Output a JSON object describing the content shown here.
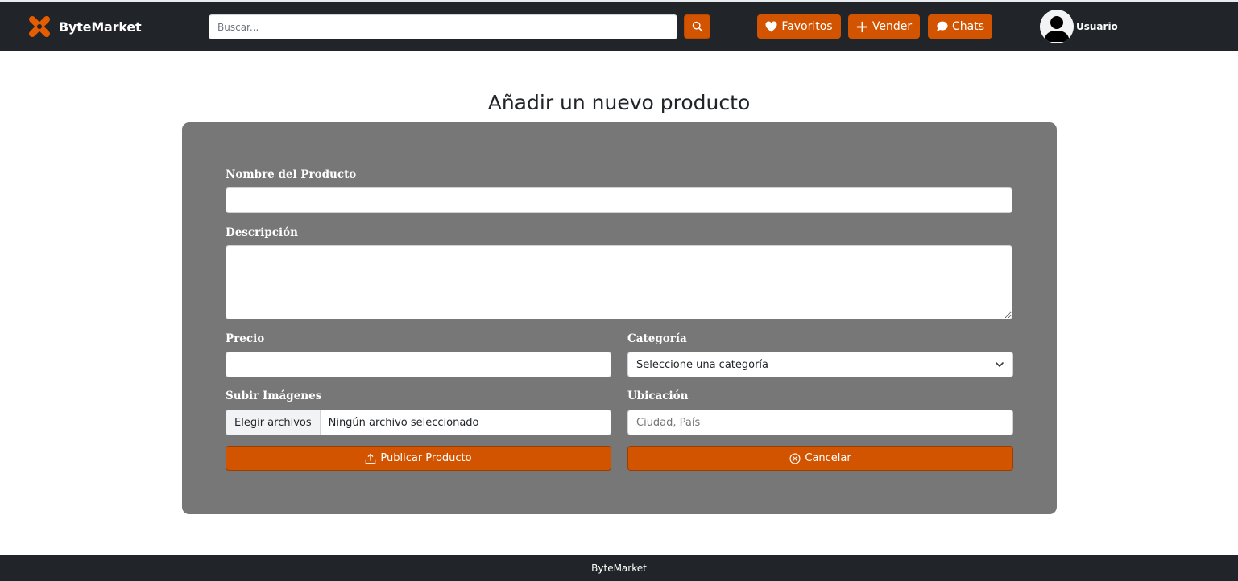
{
  "header": {
    "brand": "ByteMarket",
    "logo_icon": "bytemarket-x-logo-icon",
    "search_placeholder": "Buscar...",
    "search_icon": "search-icon",
    "buttons": {
      "favoritos": "Favoritos",
      "vender": "Vender",
      "chats": "Chats"
    },
    "user_name": "Usuario"
  },
  "page": {
    "title": "Añadir un nuevo producto"
  },
  "form": {
    "nombre_label": "Nombre del Producto",
    "nombre_value": "",
    "descripcion_label": "Descripción",
    "descripcion_value": "",
    "precio_label": "Precio",
    "precio_value": "",
    "categoria_label": "Categoría",
    "categoria_selected": "Seleccione una categoría",
    "imagenes_label": "Subir Imágenes",
    "file_button": "Elegir archivos",
    "file_status": "Ningún archivo seleccionado",
    "ubicacion_label": "Ubicación",
    "ubicacion_placeholder": "Ciudad, País",
    "publicar_button": "Publicar Producto",
    "cancelar_button": "Cancelar"
  },
  "footer": {
    "text": "ByteMarket"
  },
  "colors": {
    "accent": "#d35400",
    "navbar": "#212529",
    "card": "#777777"
  }
}
